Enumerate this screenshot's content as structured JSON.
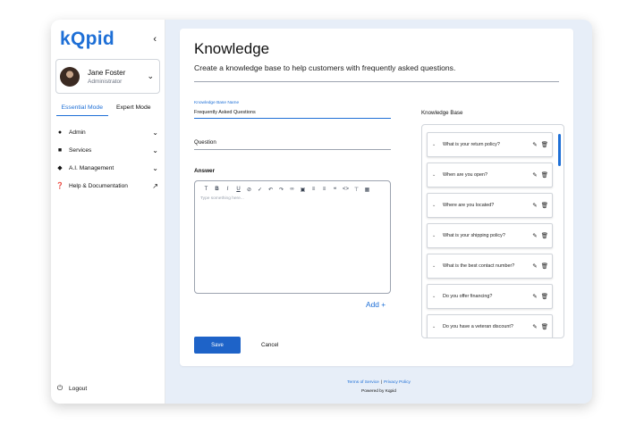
{
  "brand": {
    "logo_text": "kQpid",
    "accent_color": "#1e6fd6"
  },
  "profile": {
    "name": "Jane Foster",
    "role": "Administrator"
  },
  "modes": [
    {
      "label": "Essential Mode",
      "active": true
    },
    {
      "label": "Expert Mode",
      "active": false
    }
  ],
  "sidebar": {
    "items": [
      {
        "label": "Admin",
        "icon": "person-icon"
      },
      {
        "label": "Services",
        "icon": "chat-icon"
      },
      {
        "label": "A.I. Management",
        "icon": "layers-icon"
      },
      {
        "label": "Help & Documentation",
        "icon": "help-icon"
      }
    ],
    "logout_label": "Logout"
  },
  "page": {
    "title": "Knowledge",
    "subtitle": "Create a knowledge base to help customers with frequently asked questions."
  },
  "form": {
    "kb_name_label": "Knowledge Base Name",
    "kb_name_value": "Frequently Asked Questions",
    "question_label": "Question",
    "answer_label": "Answer",
    "answer_placeholder": "Type something here...",
    "add_label": "Add +",
    "save_label": "Save",
    "cancel_label": "Cancel"
  },
  "knowledge_base": {
    "title": "Knowledge Base",
    "items": [
      "What is your return policy?",
      "When are you open?",
      "Where are you located?",
      "What is your shipping policy?",
      "What is the best contact number?",
      "Do you offer financing?",
      "Do you have a veteran discount?"
    ]
  },
  "footer": {
    "terms": "Terms of Service",
    "privacy": "Privacy Policy",
    "powered": "Powered by Kqpid"
  }
}
